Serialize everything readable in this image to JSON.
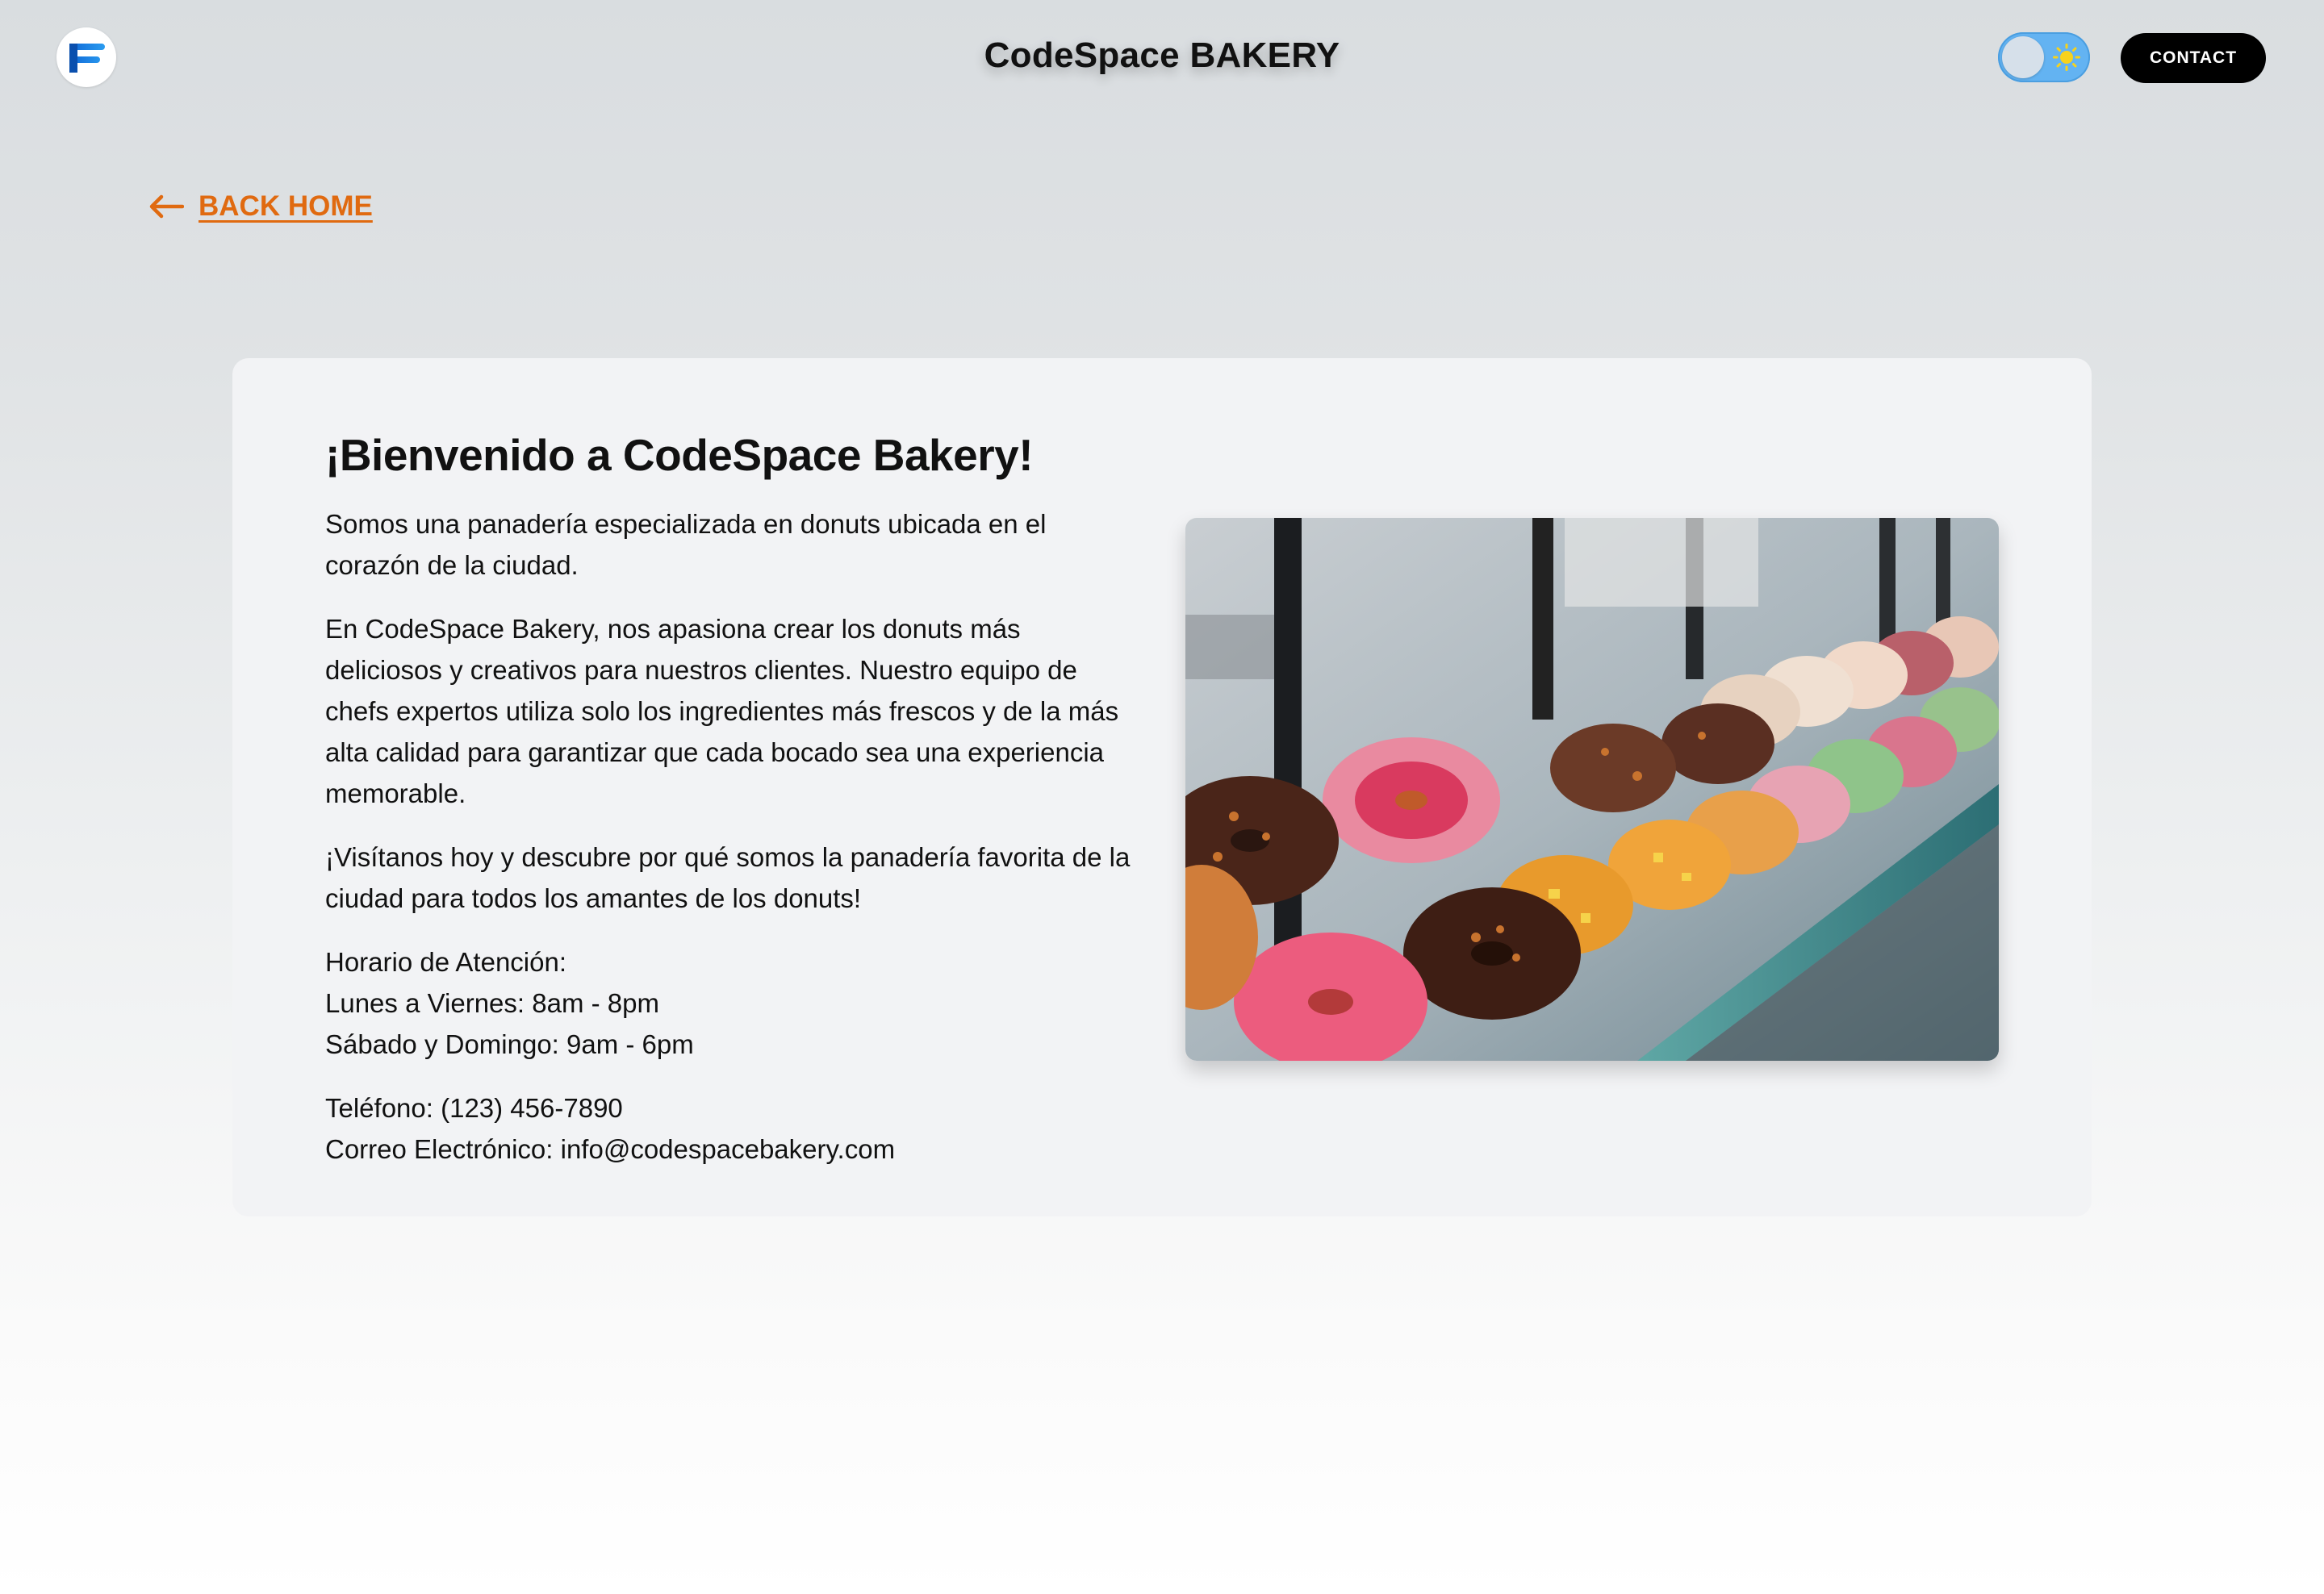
{
  "header": {
    "title": "CodeSpace BAKERY",
    "contact_label": "CONTACT",
    "logo_icon": "f-logo-icon",
    "theme_icon": "sun-icon"
  },
  "back_link": {
    "label": "BACK HOME",
    "icon": "arrow-left-icon"
  },
  "card": {
    "heading": "¡Bienvenido a CodeSpace Bakery!",
    "intro": "Somos una panadería especializada en donuts ubicada en el corazón de la ciudad.",
    "about": "En CodeSpace Bakery, nos apasiona crear los donuts más deliciosos y creativos para nuestros clientes. Nuestro equipo de chefs expertos utiliza solo los ingredientes más frescos y de la más alta calidad para garantizar que cada bocado sea una experiencia memorable.",
    "visit": "¡Visítanos hoy y descubre por qué somos la panadería favorita de la ciudad para todos los amantes de los donuts!",
    "hours_title": "Horario de Atención:",
    "hours_weekdays": "Lunes a Viernes: 8am - 8pm",
    "hours_weekend": "Sábado y Domingo: 9am - 6pm",
    "phone": "Teléfono: (123) 456-7890",
    "email": "Correo Electrónico: info@codespacebakery.com"
  },
  "colors": {
    "accent_orange": "#e06a10",
    "toggle_blue": "#63b3f2",
    "button_black": "#000000",
    "card_bg": "#f2f3f5"
  }
}
